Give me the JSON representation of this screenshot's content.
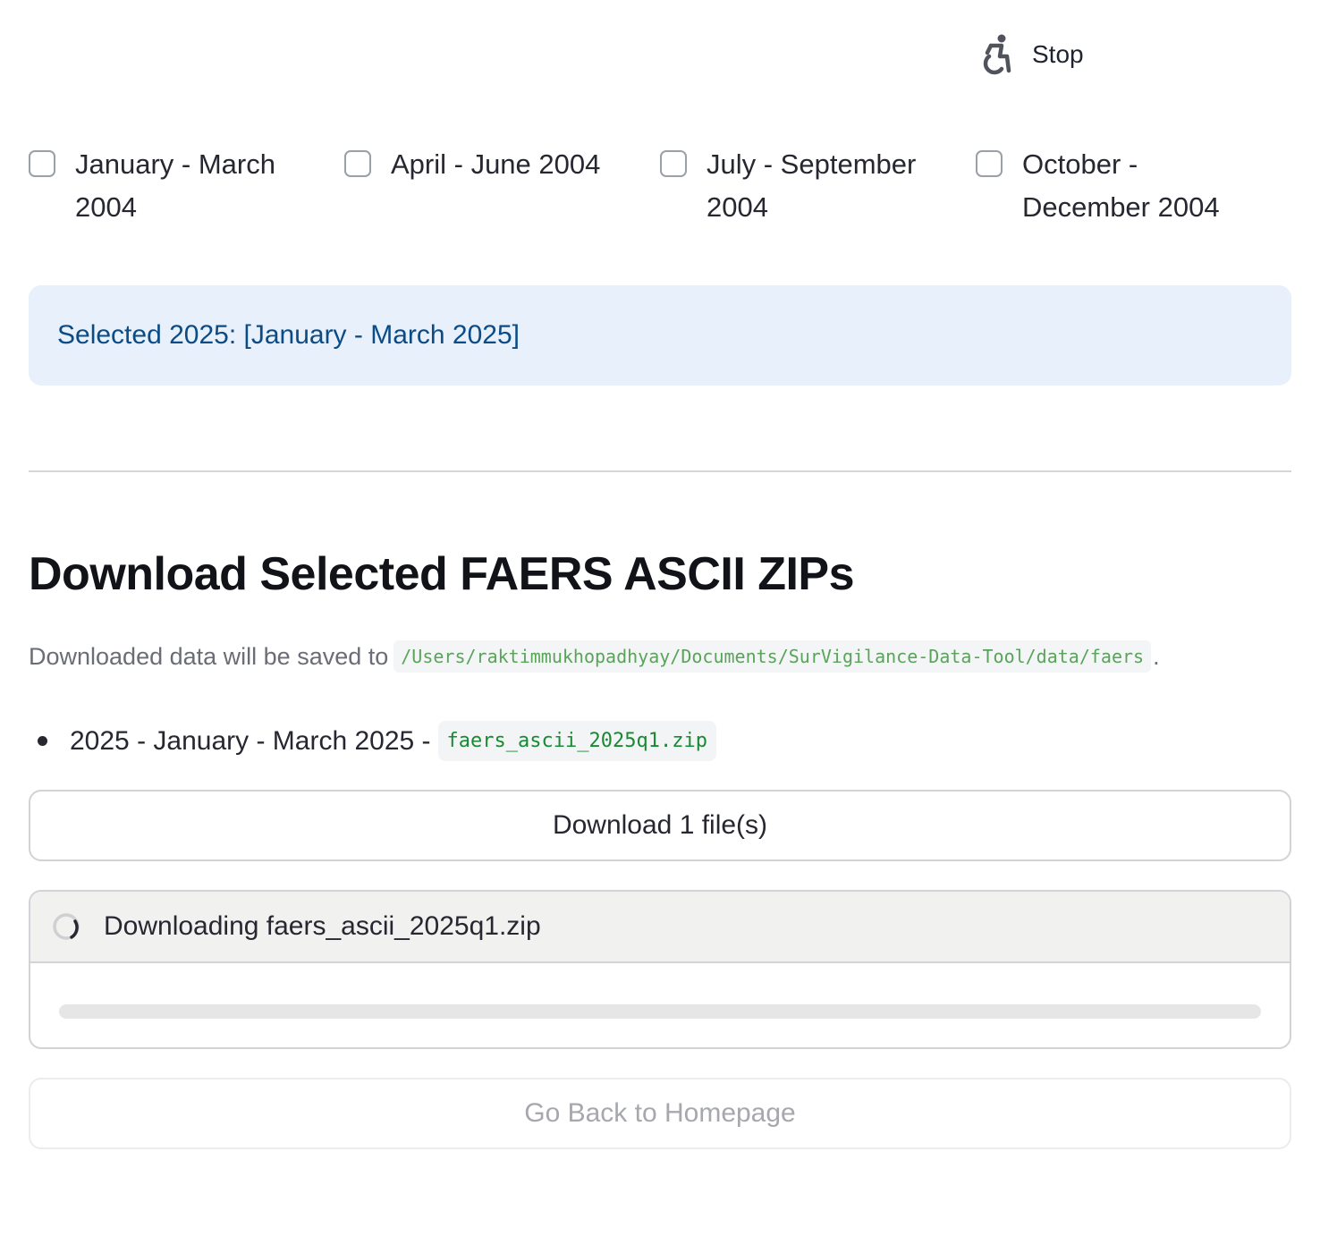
{
  "status_widget": {
    "running_icon": "running-person-icon",
    "stop_label": "Stop"
  },
  "quarters": [
    {
      "label": "January - March 2004",
      "checked": false
    },
    {
      "label": "April - June 2004",
      "checked": false
    },
    {
      "label": "July - September 2004",
      "checked": false
    },
    {
      "label": "October - December 2004",
      "checked": false
    }
  ],
  "info": {
    "text": "Selected 2025: [January - March 2025]"
  },
  "download_section": {
    "title": "Download Selected FAERS ASCII ZIPs",
    "save_prefix": "Downloaded data will be saved to",
    "save_path": "/Users/raktimmukhopadhyay/Documents/SurVigilance-Data-Tool/data/faers",
    "save_suffix": ".",
    "files": [
      {
        "text": "2025 - January - March 2025 -",
        "filename": "faers_ascii_2025q1.zip"
      }
    ],
    "download_button": "Download 1 file(s)",
    "status_text": "Downloading faers_ascii_2025q1.zip",
    "status_icon": "spinner-icon",
    "progress": 0,
    "home_button": "Go Back to Homepage"
  },
  "colors": {
    "info_bg": "#e8f0fb",
    "info_text": "#0b4b86",
    "path_code": "#5aa35a",
    "file_code": "#198a34"
  }
}
